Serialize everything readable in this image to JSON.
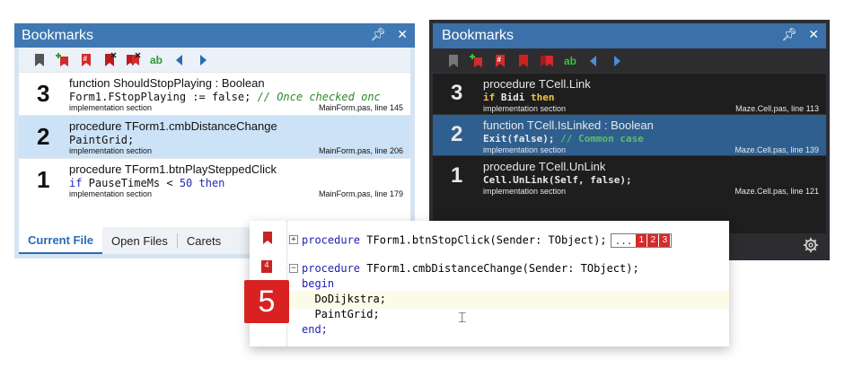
{
  "light_panel": {
    "title": "Bookmarks",
    "pin_icon": "ᵖ",
    "close_icon": "✕",
    "toolbar_ab": "ab",
    "bookmarks": [
      {
        "number": "3",
        "func": "function ShouldStopPlaying : Boolean",
        "code_plain": "Form1.FStopPlaying := false; ",
        "code_comment": "// Once checked onc",
        "section": "implementation section",
        "location": "MainForm.pas, line 145"
      },
      {
        "number": "2",
        "func": "procedure TForm1.cmbDistanceChange",
        "code_plain": "PaintGrid;",
        "section": "implementation section",
        "location": "MainForm.pas, line 206"
      },
      {
        "number": "1",
        "func": "procedure TForm1.btnPlaySteppedClick",
        "code_kw1": "if",
        "code_mid": " PauseTimeMs < ",
        "code_num": "50",
        "code_kw2": " then",
        "section": "implementation section",
        "location": "MainForm.pas, line 179"
      }
    ],
    "tabs": [
      "Current File",
      "Open Files",
      "Carets"
    ]
  },
  "dark_panel": {
    "title": "Bookmarks",
    "pin_icon": "ᵖ",
    "close_icon": "✕",
    "toolbar_ab": "ab",
    "bookmarks": [
      {
        "number": "3",
        "func": "procedure TCell.Link",
        "code_kw1": "if",
        "code_mid": " Bidi ",
        "code_kw2": "then",
        "section": "implementation section",
        "location": "Maze.Cell.pas, line 113"
      },
      {
        "number": "2",
        "func": "function TCell.IsLinked : Boolean",
        "code_plain": "Exit(false); ",
        "code_comment": "// Common case",
        "section": "implementation section",
        "location": "Maze.Cell.pas, line 139"
      },
      {
        "number": "1",
        "func": "procedure TCell.UnLink",
        "code_plain": "Cell.UnLink(Self, false);",
        "section": "implementation section",
        "location": "Maze.Cell.pas, line 121"
      }
    ]
  },
  "editor": {
    "line1_kw": "procedure",
    "line1_rest": " TForm1.btnStopClick(Sender: TObject);",
    "mini_dots": "...",
    "mini_marks": [
      "1",
      "2",
      "3"
    ],
    "line2_kw": "procedure",
    "line2_rest": " TForm1.cmbDistanceChange(Sender: TObject);",
    "line3": "begin",
    "line4": "  DoDijkstra;",
    "line5": "  PaintGrid;",
    "line6": "end;",
    "gutter_badge": "4",
    "big_badge": "5"
  },
  "colors": {
    "accent": "#3f78b3",
    "bookmark_red": "#d32b2b",
    "selection_light": "#cce2f7",
    "selection_dark": "#2e5f8f"
  },
  "icons": [
    "bookmark-icon",
    "add-bookmark-icon",
    "numbered-bookmark-icon",
    "delete-bookmark-icon",
    "delete-all-icon",
    "find-text-icon",
    "previous-icon",
    "next-icon",
    "gear-icon",
    "fold-icon"
  ]
}
